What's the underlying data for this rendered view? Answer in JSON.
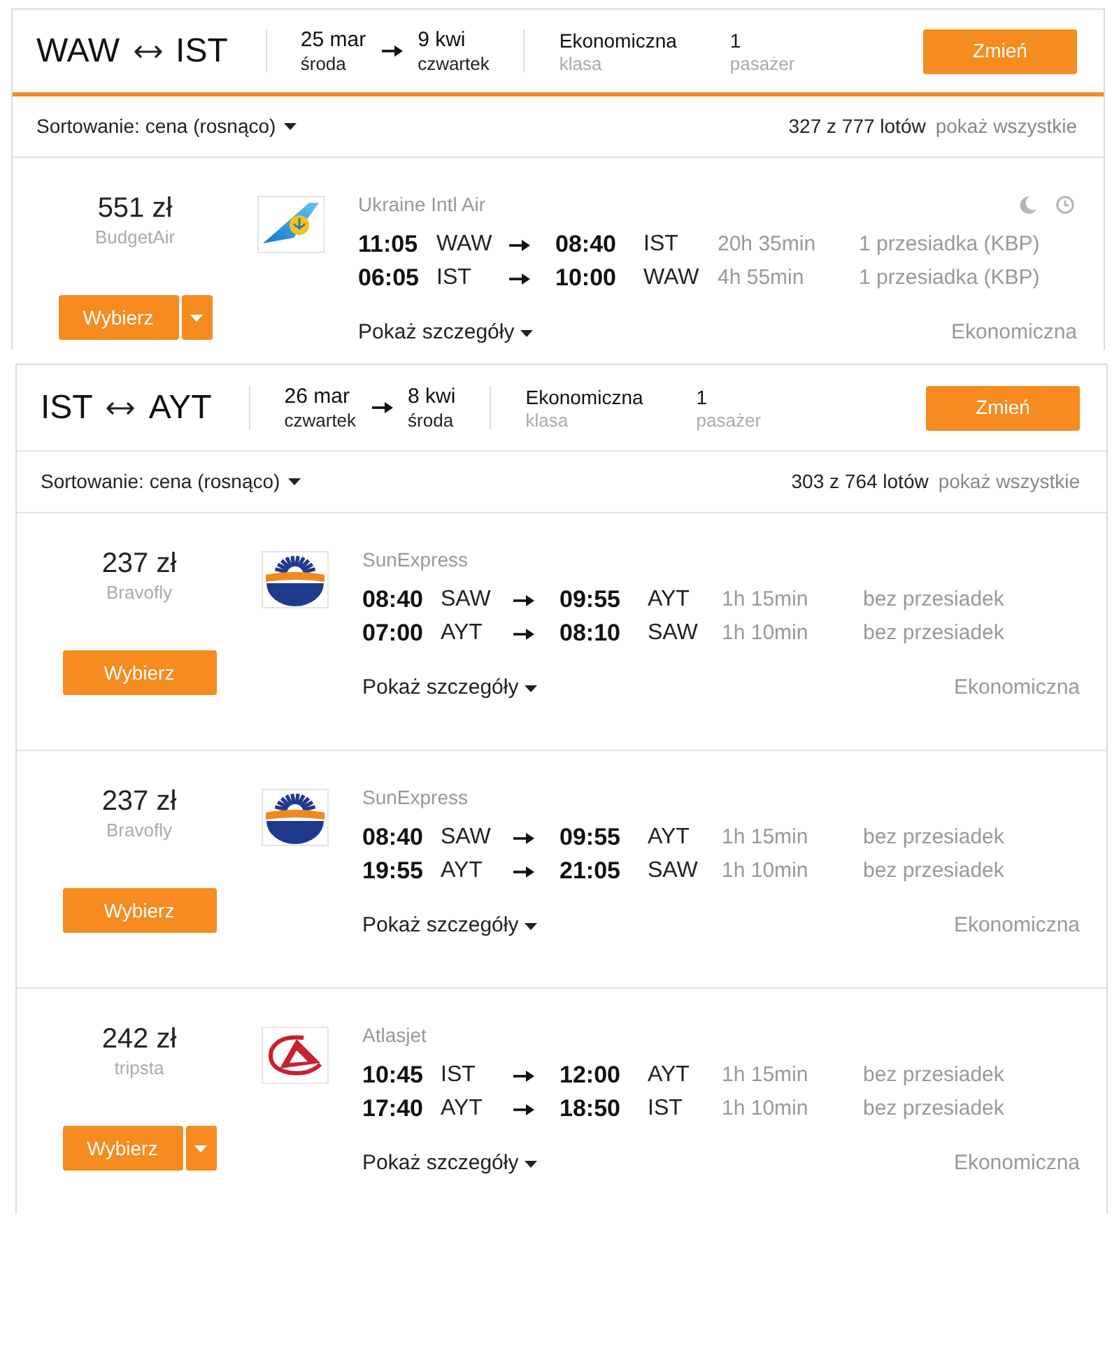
{
  "searches": [
    {
      "highlighted": true,
      "route": {
        "from": "WAW",
        "to": "IST"
      },
      "outbound": {
        "date": "25 mar",
        "weekday": "środa"
      },
      "inbound": {
        "date": "9 kwi",
        "weekday": "czwartek"
      },
      "cabin": {
        "value": "Ekonomiczna",
        "label": "klasa"
      },
      "passengers": {
        "value": "1",
        "label": "pasażer"
      },
      "change_button": "Zmień",
      "sort": "Sortowanie: cena (rosnąco)",
      "count": "327 z 777 lotów",
      "show_all": "pokaż wszystkie",
      "results": [
        {
          "price": "551 zł",
          "provider": "BudgetAir",
          "select_button": "Wybierz",
          "more_offers": true,
          "logo": {
            "kind": "tail"
          },
          "airline": "Ukraine Intl Air",
          "icons": [
            {
              "kind": "moon"
            },
            {
              "kind": "clock"
            }
          ],
          "legs": [
            {
              "depart": "11:05",
              "from": "WAW",
              "arrive": "08:40",
              "to": "IST",
              "duration": "20h 35min",
              "stops": "1 przesiadka (KBP)"
            },
            {
              "depart": "06:05",
              "from": "IST",
              "arrive": "10:00",
              "to": "WAW",
              "duration": "4h 55min",
              "stops": "1 przesiadka (KBP)"
            }
          ],
          "details": "Pokaż szczegóły",
          "cabin": "Ekonomiczna"
        }
      ]
    },
    {
      "highlighted": false,
      "route": {
        "from": "IST",
        "to": "AYT"
      },
      "outbound": {
        "date": "26 mar",
        "weekday": "czwartek"
      },
      "inbound": {
        "date": "8 kwi",
        "weekday": "środa"
      },
      "cabin": {
        "value": "Ekonomiczna",
        "label": "klasa"
      },
      "passengers": {
        "value": "1",
        "label": "pasażer"
      },
      "change_button": "Zmień",
      "sort": "Sortowanie: cena (rosnąco)",
      "count": "303 z 764 lotów",
      "show_all": "pokaż wszystkie",
      "results": [
        {
          "price": "237 zł",
          "provider": "Bravofly",
          "select_button": "Wybierz",
          "more_offers": false,
          "logo": {
            "kind": "sun"
          },
          "airline": "SunExpress",
          "legs": [
            {
              "depart": "08:40",
              "from": "SAW",
              "arrive": "09:55",
              "to": "AYT",
              "duration": "1h 15min",
              "stops": "bez przesiadek"
            },
            {
              "depart": "07:00",
              "from": "AYT",
              "arrive": "08:10",
              "to": "SAW",
              "duration": "1h 10min",
              "stops": "bez przesiadek"
            }
          ],
          "details": "Pokaż szczegóły",
          "cabin": "Ekonomiczna"
        },
        {
          "price": "237 zł",
          "provider": "Bravofly",
          "select_button": "Wybierz",
          "more_offers": false,
          "logo": {
            "kind": "sun"
          },
          "airline": "SunExpress",
          "legs": [
            {
              "depart": "08:40",
              "from": "SAW",
              "arrive": "09:55",
              "to": "AYT",
              "duration": "1h 15min",
              "stops": "bez przesiadek"
            },
            {
              "depart": "19:55",
              "from": "AYT",
              "arrive": "21:05",
              "to": "SAW",
              "duration": "1h 10min",
              "stops": "bez przesiadek"
            }
          ],
          "details": "Pokaż szczegóły",
          "cabin": "Ekonomiczna"
        },
        {
          "price": "242 zł",
          "provider": "tripsta",
          "select_button": "Wybierz",
          "more_offers": true,
          "logo": {
            "kind": "arrow"
          },
          "airline": "Atlasjet",
          "legs": [
            {
              "depart": "10:45",
              "from": "IST",
              "arrive": "12:00",
              "to": "AYT",
              "duration": "1h 15min",
              "stops": "bez przesiadek"
            },
            {
              "depart": "17:40",
              "from": "AYT",
              "arrive": "18:50",
              "to": "IST",
              "duration": "1h 10min",
              "stops": "bez przesiadek"
            }
          ],
          "details": "Pokaż szczegóły",
          "cabin": "Ekonomiczna"
        }
      ]
    }
  ]
}
